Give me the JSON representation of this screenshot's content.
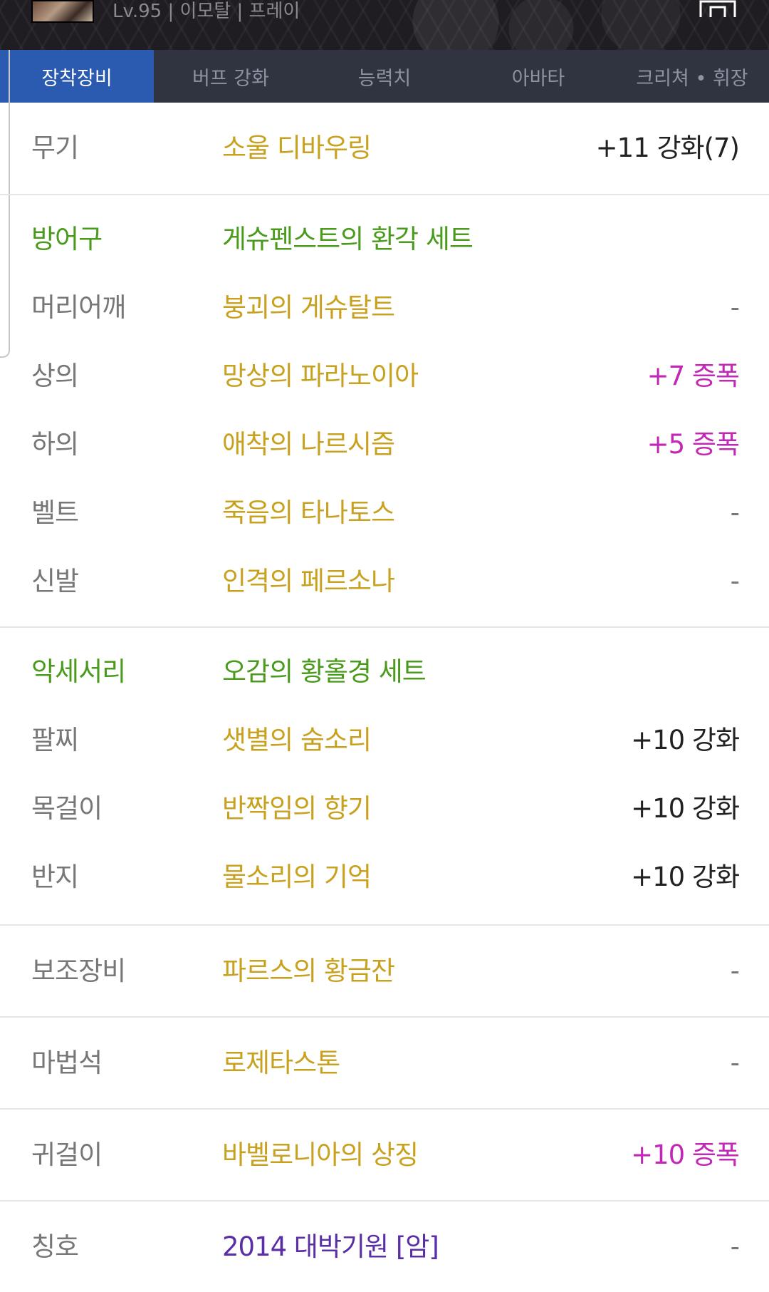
{
  "header": {
    "char_info": "Lv.95 | 이모탈 | 프레이"
  },
  "tabs": [
    {
      "label": "장착장비",
      "active": true
    },
    {
      "label": "버프 강화",
      "active": false
    },
    {
      "label": "능력치",
      "active": false
    },
    {
      "label": "아바타",
      "active": false
    },
    {
      "label": "크리쳐 • 휘장",
      "active": false
    }
  ],
  "colors": {
    "tab_active": "#2a5bb0",
    "tab_bar": "#2f3440",
    "item_name": "#c8a21e",
    "set_name": "#4a9a1c",
    "amplify": "#c227b5",
    "title_item": "#5a2ea6"
  },
  "equipment": {
    "weapon": {
      "slot": "무기",
      "name": "소울 디바우링",
      "status": "+11 강화(7)"
    },
    "armor": {
      "category": "방어구",
      "set": "게슈펜스트의 환각 세트",
      "items": [
        {
          "slot": "머리어깨",
          "name": "붕괴의 게슈탈트",
          "status": "-"
        },
        {
          "slot": "상의",
          "name": "망상의 파라노이아",
          "status": "+7 증폭"
        },
        {
          "slot": "하의",
          "name": "애착의 나르시즘",
          "status": "+5 증폭"
        },
        {
          "slot": "벨트",
          "name": "죽음의 타나토스",
          "status": "-"
        },
        {
          "slot": "신발",
          "name": "인격의 페르소나",
          "status": "-"
        }
      ]
    },
    "accessory": {
      "category": "악세서리",
      "set": "오감의 황홀경 세트",
      "items": [
        {
          "slot": "팔찌",
          "name": "샛별의 숨소리",
          "status": "+10 강화"
        },
        {
          "slot": "목걸이",
          "name": "반짝임의 향기",
          "status": "+10 강화"
        },
        {
          "slot": "반지",
          "name": "물소리의 기억",
          "status": "+10 강화"
        }
      ]
    },
    "sub": {
      "slot": "보조장비",
      "name": "파르스의 황금잔",
      "status": "-"
    },
    "magic_stone": {
      "slot": "마법석",
      "name": "로제타스톤",
      "status": "-"
    },
    "earring": {
      "slot": "귀걸이",
      "name": "바벨로니아의 상징",
      "status": "+10 증폭"
    },
    "title": {
      "slot": "칭호",
      "name": "2014 대박기원 [암]",
      "status": "-"
    }
  }
}
